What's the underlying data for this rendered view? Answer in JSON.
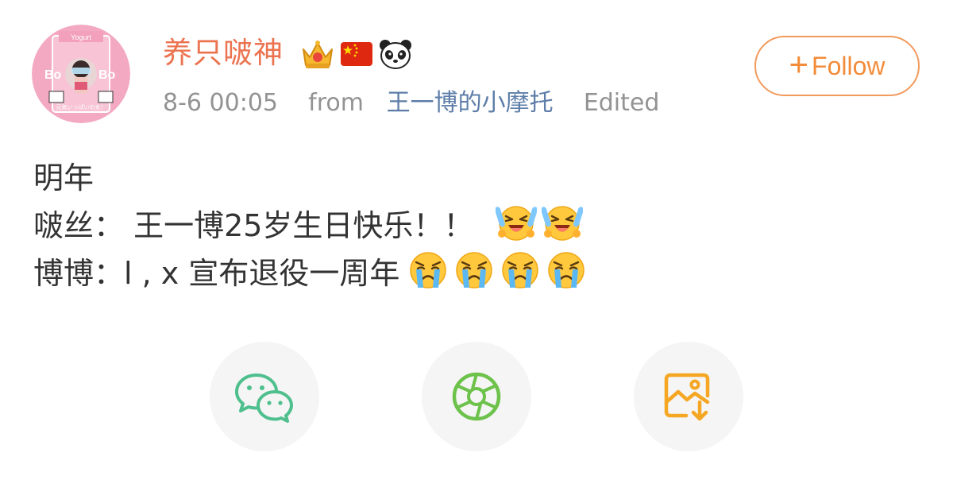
{
  "user": {
    "name": "养只啵神",
    "avatar_text_top": "Yogurt",
    "avatar_text_bo": "Bo",
    "avatar_text_caption": "元気いっぱいの女！",
    "badges": [
      "crown-badge-icon",
      "china-flag-icon",
      "panda-icon"
    ]
  },
  "meta": {
    "time": "8-6 00:05",
    "from_label": "from",
    "source": "王一博的小摩托",
    "edited": "Edited"
  },
  "follow": {
    "plus": "+",
    "label": "Follow"
  },
  "post": {
    "line1": "明年",
    "line2": "啵丝： 王一博25岁生日快乐！！",
    "line3": "博博：l , x 宣布退役一周年",
    "line2_emojis": [
      "laugh-cry-emoji",
      "laugh-cry-emoji"
    ],
    "line3_emojis": [
      "crying-emoji",
      "crying-emoji",
      "crying-emoji",
      "crying-emoji"
    ]
  },
  "share": [
    "wechat-icon",
    "moments-icon",
    "save-image-icon"
  ],
  "colors": {
    "username": "#eb7350",
    "meta": "#939393",
    "source": "#5d7da8",
    "follow": "#f28c3a",
    "wechat": "#4fc08d",
    "moments": "#6cc24a",
    "save": "#f5a623"
  }
}
